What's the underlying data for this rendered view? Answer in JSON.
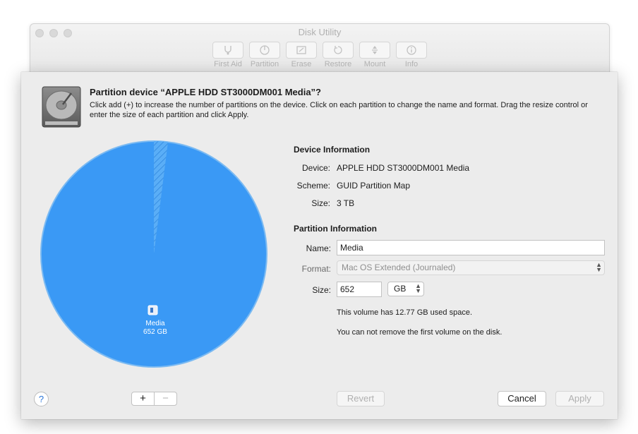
{
  "window": {
    "title": "Disk Utility",
    "toolbar": [
      {
        "label": "First Aid",
        "icon": "stethoscope-icon"
      },
      {
        "label": "Partition",
        "icon": "partition-icon"
      },
      {
        "label": "Erase",
        "icon": "erase-icon"
      },
      {
        "label": "Restore",
        "icon": "restore-icon"
      },
      {
        "label": "Mount",
        "icon": "mount-icon"
      },
      {
        "label": "Info",
        "icon": "info-icon"
      }
    ]
  },
  "sheet": {
    "title": "Partition device “APPLE HDD ST3000DM001 Media”?",
    "description": "Click add (+) to increase the number of partitions on the device. Click on each partition to change the name and format. Drag the resize control or enter the size of each partition and click Apply."
  },
  "pie": {
    "partition_name": "Media",
    "partition_size": "652 GB",
    "fill_color": "#3a99f5",
    "used_fraction": 0.02
  },
  "device_info": {
    "heading": "Device Information",
    "device_label": "Device:",
    "device_value": "APPLE HDD ST3000DM001 Media",
    "scheme_label": "Scheme:",
    "scheme_value": "GUID Partition Map",
    "size_label": "Size:",
    "size_value": "3 TB"
  },
  "partition_info": {
    "heading": "Partition Information",
    "name_label": "Name:",
    "name_value": "Media",
    "format_label": "Format:",
    "format_value": "Mac OS Extended (Journaled)",
    "size_label": "Size:",
    "size_value": "652",
    "unit_value": "GB",
    "used_note": "This volume has 12.77 GB used space.",
    "remove_note": "You can not remove the first volume on the disk."
  },
  "buttons": {
    "help": "?",
    "add": "+",
    "remove": "−",
    "revert": "Revert",
    "cancel": "Cancel",
    "apply": "Apply"
  }
}
